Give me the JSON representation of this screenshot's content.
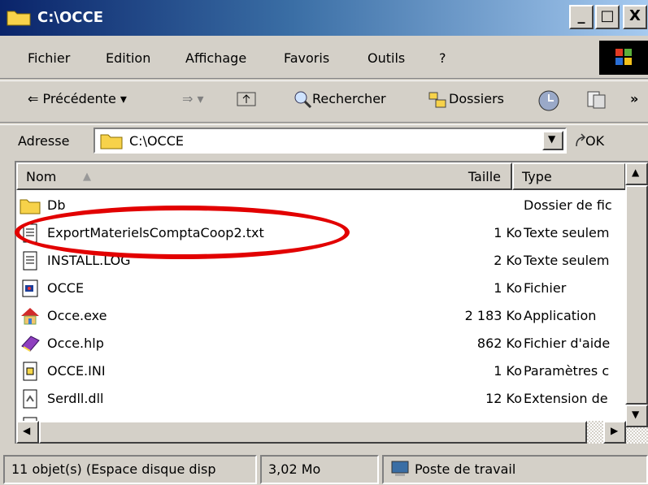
{
  "window": {
    "title": "C:\\OCCE",
    "min": "_",
    "max": "□",
    "close": "X"
  },
  "menu": [
    "Fichier",
    "Edition",
    "Affichage",
    "Favoris",
    "Outils",
    "?"
  ],
  "toolbar": {
    "back": "Précédente",
    "search": "Rechercher",
    "folders": "Dossiers"
  },
  "address": {
    "label": "Adresse",
    "value": "C:\\OCCE",
    "go": "OK"
  },
  "columns": {
    "name": "Nom",
    "size": "Taille",
    "type": "Type"
  },
  "files": [
    {
      "name": "Db",
      "size": "",
      "type": "Dossier de fic"
    },
    {
      "name": "ExportMaterielsComptaCoop2.txt",
      "size": "1 Ko",
      "type": "Texte seulem"
    },
    {
      "name": "INSTALL.LOG",
      "size": "2 Ko",
      "type": "Texte seulem"
    },
    {
      "name": "OCCE",
      "size": "1 Ko",
      "type": "Fichier"
    },
    {
      "name": "Occe.exe",
      "size": "2 183 Ko",
      "type": "Application"
    },
    {
      "name": "Occe.hlp",
      "size": "862 Ko",
      "type": "Fichier d'aide"
    },
    {
      "name": "OCCE.INI",
      "size": "1 Ko",
      "type": "Paramètres c"
    },
    {
      "name": "Serdll.dll",
      "size": "12 Ko",
      "type": "Extension de"
    }
  ],
  "status": {
    "count": "11 objet(s) (Espace disque disp",
    "size": "3,02 Mo",
    "location": "Poste de travail"
  },
  "colors": {
    "highlight_oval": "#e20000",
    "title_gradient_start": "#0a246a"
  }
}
